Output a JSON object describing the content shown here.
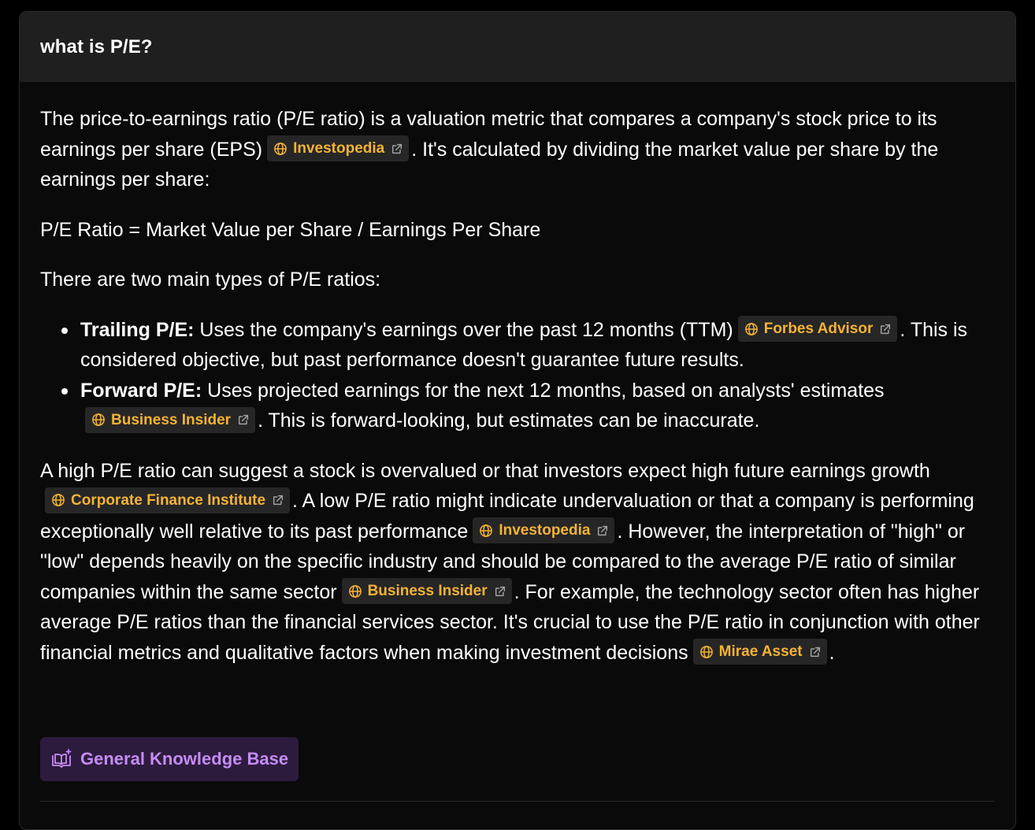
{
  "header": {
    "question": "what is P/E?"
  },
  "answer": {
    "p1": {
      "text_a": "The price-to-earnings ratio (P/E ratio) is a valuation metric that compares a company's stock price to its earnings per share (EPS)",
      "cite_1": "Investopedia",
      "text_b": ". It's calculated by dividing the market value per share by the earnings per share:"
    },
    "formula": "P/E Ratio = Market Value per Share / Earnings Per Share",
    "intro_types": "There are two main types of P/E ratios:",
    "types": [
      {
        "term": "Trailing P/E:",
        "text_a": " Uses the company's earnings over the past 12 months (TTM)",
        "cite": "Forbes Advisor",
        "text_b": ". This is considered objective, but past performance doesn't guarantee future results."
      },
      {
        "term": "Forward P/E:",
        "text_a": " Uses projected earnings for the next 12 months, based on analysts' estimates",
        "cite": "Business Insider",
        "text_b": ". This is forward-looking, but estimates can be inaccurate."
      }
    ],
    "p4": {
      "text_a": "A high P/E ratio can suggest a stock is overvalued or that investors expect high future earnings growth",
      "cite_1": "Corporate Finance Institute",
      "text_b": ". A low P/E ratio might indicate undervaluation or that a company is performing exceptionally well relative to its past performance",
      "cite_2": "Investopedia",
      "text_c": ". However, the interpretation of \"high\" or \"low\" depends heavily on the specific industry and should be compared to the average P/E ratio of similar companies within the same sector",
      "cite_3": "Business Insider",
      "text_d": ". For example, the technology sector often has higher average P/E ratios than the financial services sector. It's crucial to use the P/E ratio in conjunction with other financial metrics and qualitative factors when making investment decisions",
      "cite_4": "Mirae Asset",
      "text_e": "."
    }
  },
  "knowledge_base_button": {
    "label": "General Knowledge Base",
    "icon": "book-sparkle-icon"
  },
  "icons": {
    "citation": "globe-icon",
    "external": "external-link-icon"
  },
  "colors": {
    "background": "#000000",
    "card": "#0a0a0a",
    "header": "#1f1f1f",
    "citation_chip": "#262626",
    "citation_text": "#f5b335",
    "kb_button_bg": "#2d1b3d",
    "kb_button_text": "#c58cf5"
  }
}
